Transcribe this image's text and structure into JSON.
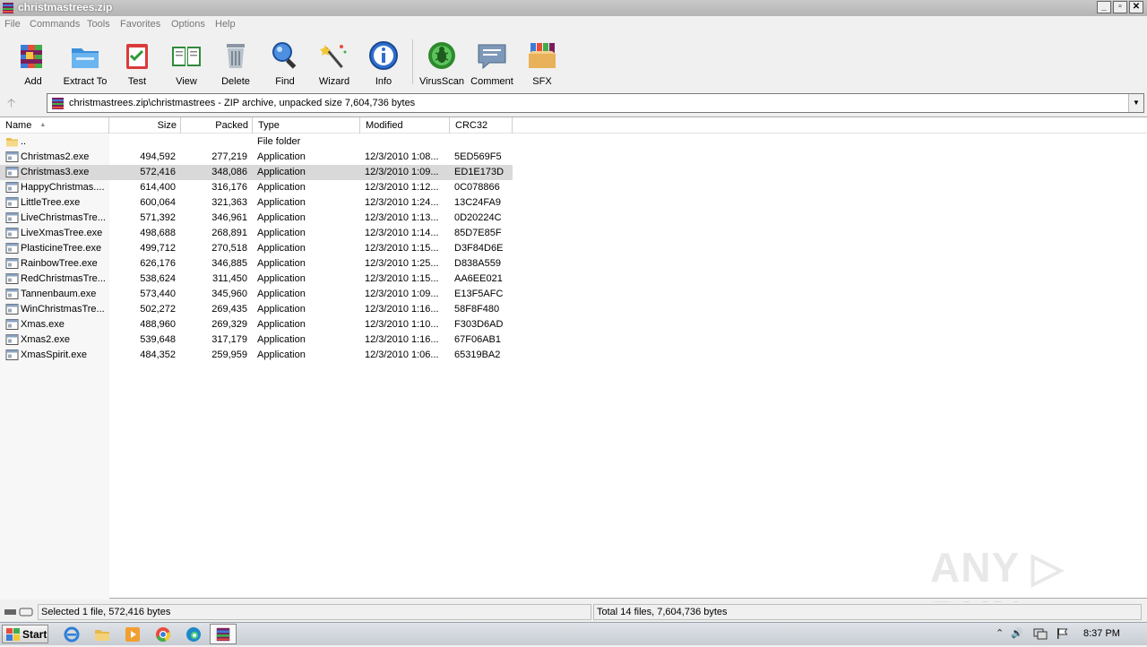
{
  "window": {
    "title": "christmastrees.zip",
    "buttons": [
      "_",
      "▫",
      "✕"
    ]
  },
  "menu": [
    "File",
    "Commands",
    "Tools",
    "Favorites",
    "Options",
    "Help"
  ],
  "toolbar": {
    "add": "Add",
    "extract_to": "Extract To",
    "test": "Test",
    "view": "View",
    "delete": "Delete",
    "find": "Find",
    "wizard": "Wizard",
    "info": "Info",
    "virusscan": "VirusScan",
    "comment": "Comment",
    "sfx": "SFX"
  },
  "address": {
    "up": "🡡",
    "path": "christmastrees.zip\\christmastrees - ZIP archive, unpacked size 7,604,736 bytes",
    "dropdown": "▼"
  },
  "columns": {
    "name": "Name",
    "sort_arrow": "▲",
    "size": "Size",
    "packed": "Packed",
    "type": "Type",
    "modified": "Modified",
    "crc32": "CRC32"
  },
  "rows": [
    {
      "name": "..",
      "size": "",
      "packed": "",
      "type": "File folder",
      "modified": "",
      "crc": "",
      "icon": "folder-icon"
    },
    {
      "name": "Christmas2.exe",
      "size": "494,592",
      "packed": "277,219",
      "type": "Application",
      "modified": "12/3/2010 1:08...",
      "crc": "5ED569F5",
      "icon": "exe-icon"
    },
    {
      "name": "Christmas3.exe",
      "size": "572,416",
      "packed": "348,086",
      "type": "Application",
      "modified": "12/3/2010 1:09...",
      "crc": "ED1E173D",
      "icon": "exe-icon",
      "selected": true
    },
    {
      "name": "HappyChristmas....",
      "size": "614,400",
      "packed": "316,176",
      "type": "Application",
      "modified": "12/3/2010 1:12...",
      "crc": "0C078866",
      "icon": "exe-icon"
    },
    {
      "name": "LittleTree.exe",
      "size": "600,064",
      "packed": "321,363",
      "type": "Application",
      "modified": "12/3/2010 1:24...",
      "crc": "13C24FA9",
      "icon": "exe-icon"
    },
    {
      "name": "LiveChristmasTre...",
      "size": "571,392",
      "packed": "346,961",
      "type": "Application",
      "modified": "12/3/2010 1:13...",
      "crc": "0D20224C",
      "icon": "exe-icon"
    },
    {
      "name": "LiveXmasTree.exe",
      "size": "498,688",
      "packed": "268,891",
      "type": "Application",
      "modified": "12/3/2010 1:14...",
      "crc": "85D7E85F",
      "icon": "exe-icon"
    },
    {
      "name": "PlasticineTree.exe",
      "size": "499,712",
      "packed": "270,518",
      "type": "Application",
      "modified": "12/3/2010 1:15...",
      "crc": "D3F84D6E",
      "icon": "exe-icon"
    },
    {
      "name": "RainbowTree.exe",
      "size": "626,176",
      "packed": "346,885",
      "type": "Application",
      "modified": "12/3/2010 1:25...",
      "crc": "D838A559",
      "icon": "exe-icon"
    },
    {
      "name": "RedChristmasTre...",
      "size": "538,624",
      "packed": "311,450",
      "type": "Application",
      "modified": "12/3/2010 1:15...",
      "crc": "AA6EE021",
      "icon": "exe-icon"
    },
    {
      "name": "Tannenbaum.exe",
      "size": "573,440",
      "packed": "345,960",
      "type": "Application",
      "modified": "12/3/2010 1:09...",
      "crc": "E13F5AFC",
      "icon": "exe-icon"
    },
    {
      "name": "WinChristmasTre...",
      "size": "502,272",
      "packed": "269,435",
      "type": "Application",
      "modified": "12/3/2010 1:16...",
      "crc": "58F8F480",
      "icon": "exe-icon"
    },
    {
      "name": "Xmas.exe",
      "size": "488,960",
      "packed": "269,329",
      "type": "Application",
      "modified": "12/3/2010 1:10...",
      "crc": "F303D6AD",
      "icon": "exe-icon"
    },
    {
      "name": "Xmas2.exe",
      "size": "539,648",
      "packed": "317,179",
      "type": "Application",
      "modified": "12/3/2010 1:16...",
      "crc": "67F06AB1",
      "icon": "exe-icon"
    },
    {
      "name": "XmasSpirit.exe",
      "size": "484,352",
      "packed": "259,959",
      "type": "Application",
      "modified": "12/3/2010 1:06...",
      "crc": "65319BA2",
      "icon": "exe-icon"
    }
  ],
  "status": {
    "left": "Selected 1 file, 572,416 bytes",
    "right": "Total 14 files, 7,604,736 bytes"
  },
  "watermark": "ANY ▷ RUN",
  "taskbar": {
    "start": "Start",
    "clock": "8:37 PM",
    "tray_arrow": "⌃",
    "volume": "🔊"
  },
  "colors": {
    "selected_row": "#d9d9d9",
    "titlebar": "#b4b4b4"
  }
}
